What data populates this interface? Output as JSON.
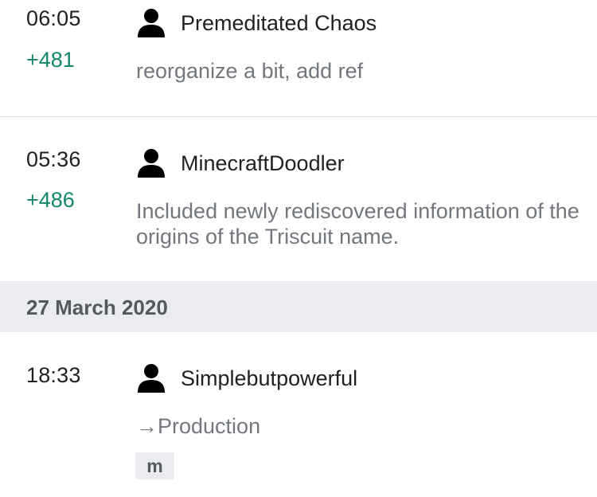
{
  "revisions_top": [
    {
      "time": "06:05",
      "diff": "+481",
      "user": "Premeditated Chaos",
      "user_icon": "user-icon",
      "summary": "reorganize a bit, add ref"
    },
    {
      "time": "05:36",
      "diff": "+486",
      "user": "MinecraftDoodler",
      "user_icon": "user-icon",
      "summary": "Included newly rediscovered information of the origins of the Triscuit name."
    }
  ],
  "date_header": "27 March 2020",
  "revisions_bottom": [
    {
      "time": "18:33",
      "user": "Simplebutpowerful",
      "user_icon": "user-icon",
      "summary": "→Production",
      "tag": "m"
    }
  ],
  "colors": {
    "positive_diff": "#14866d",
    "summary_text": "#72777d",
    "header_bg": "#eaecf0"
  }
}
